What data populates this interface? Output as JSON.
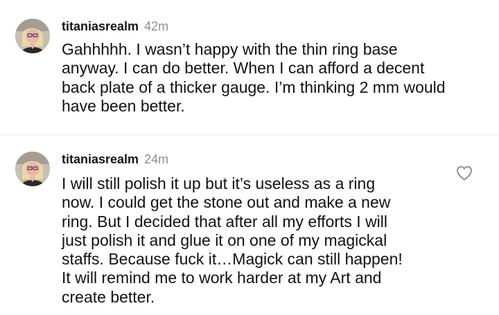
{
  "comments": [
    {
      "username": "titaniasrealm",
      "timestamp": "42m",
      "text": "Gahhhhh.  I wasn’t happy with the thin ring base\nanyway. I can do better.  When I can afford a decent\nback plate of a thicker gauge.  I’m thinking 2 mm would\nhave been better.",
      "avatar_icon": "user-avatar"
    },
    {
      "username": "titaniasrealm",
      "timestamp": "24m",
      "text": "I will still polish it up but it’s useless as a ring\nnow. I could get the stone out and make a new\nring.  But I decided that after all my efforts I will\njust polish it and glue it on one of my magickal\nstaffs. Because fuck it…Magick can still happen!\nIt will remind me to work harder at my Art and\ncreate better.",
      "avatar_icon": "user-avatar",
      "like_icon": "heart-outline-icon"
    }
  ]
}
